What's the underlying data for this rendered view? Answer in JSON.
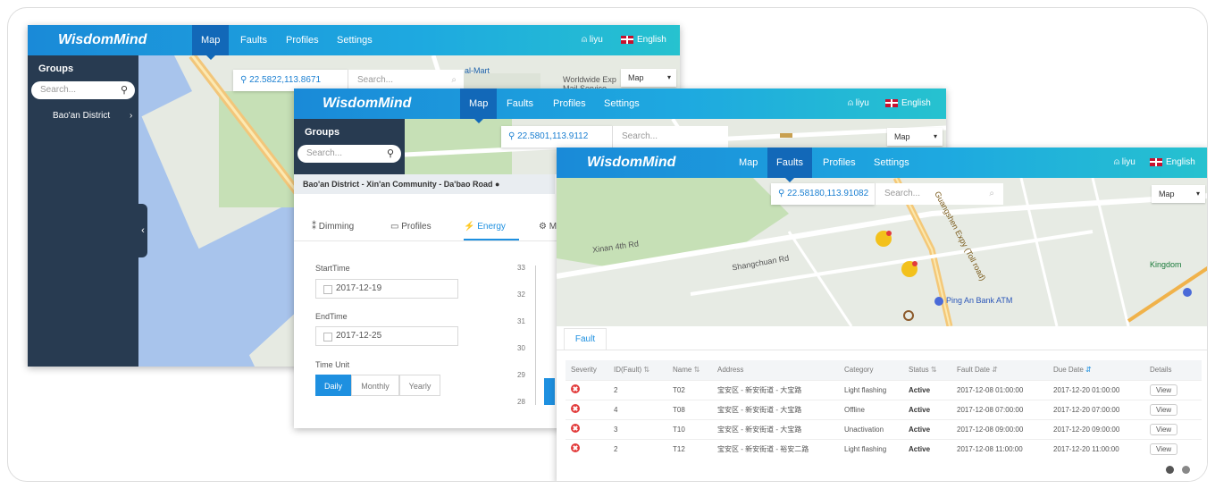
{
  "brand": "WisdomMind",
  "nav": [
    "Map",
    "Faults",
    "Profiles",
    "Settings"
  ],
  "user": "liyu",
  "language": "English",
  "colors": {
    "topbar": "#1ea9e0",
    "nav_active": "#1268b8",
    "sidebar": "#283b51",
    "accent": "#1e90e0",
    "severity": "#e23b3b"
  },
  "icons": {
    "user": "user-icon",
    "flag": "uk-flag-icon",
    "search": "search-icon",
    "chevron": "chevron-right-icon",
    "collapse": "chevron-left-icon",
    "location": "location-pin-icon"
  },
  "screen1": {
    "groups_title": "Groups",
    "search_placeholder": "Search...",
    "district": "Bao'an District",
    "coord": "22.5822,113.8671",
    "map_search_placeholder": "Search...",
    "map_type": "Map",
    "map_labels": [
      "Worldwide Exp",
      "Mail Service",
      "al-Mart"
    ]
  },
  "screen2": {
    "groups_title": "Groups",
    "search_placeholder": "Search...",
    "coord": "22.5801,113.9112",
    "map_search_placeholder": "Search...",
    "map_type": "Map",
    "breadcrumb": "Bao'an District - Xin'an Community - Da'bao Road",
    "tabs": [
      "Dimming",
      "Profiles",
      "Energy",
      "M"
    ],
    "start_label": "StartTime",
    "start_value": "2017-12-19",
    "end_label": "EndTime",
    "end_value": "2017-12-25",
    "unit_label": "Time Unit",
    "units": [
      "Daily",
      "Monthly",
      "Yearly"
    ],
    "y_ticks": [
      "33",
      "32",
      "31",
      "30",
      "29",
      "28"
    ]
  },
  "screen3": {
    "coord": "22.58180,113.91082",
    "map_search_placeholder": "Search...",
    "map_type": "Map",
    "map_labels": [
      "Xinan 4th Rd",
      "Shangchuan Rd",
      "Ping An Bank ATM",
      "Guangshen Expy (Toll road)",
      "Kingdom"
    ],
    "panel_tab": "Fault",
    "columns": [
      "Severity",
      "ID(Fault)",
      "Name",
      "Address",
      "Category",
      "Status",
      "Fault Date",
      "Due Date",
      "Details"
    ],
    "rows": [
      {
        "id": "2",
        "name": "T02",
        "address": "宝安区 - 新安街道 - 大宝路",
        "category": "Light flashing",
        "status": "Active",
        "fault_date": "2017-12-08 01:00:00",
        "due_date": "2017-12-20 01:00:00",
        "details": "View"
      },
      {
        "id": "4",
        "name": "T08",
        "address": "宝安区 - 新安街道 - 大宝路",
        "category": "Offline",
        "status": "Active",
        "fault_date": "2017-12-08 07:00:00",
        "due_date": "2017-12-20 07:00:00",
        "details": "View"
      },
      {
        "id": "3",
        "name": "T10",
        "address": "宝安区 - 新安街道 - 大宝路",
        "category": "Unactivation",
        "status": "Active",
        "fault_date": "2017-12-08 09:00:00",
        "due_date": "2017-12-20 09:00:00",
        "details": "View"
      },
      {
        "id": "2",
        "name": "T12",
        "address": "宝安区 - 新安街道 - 裕安二路",
        "category": "Light flashing",
        "status": "Active",
        "fault_date": "2017-12-08 11:00:00",
        "due_date": "2017-12-20 11:00:00",
        "details": "View"
      }
    ]
  }
}
